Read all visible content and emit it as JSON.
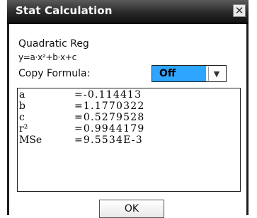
{
  "window": {
    "title": "Stat Calculation"
  },
  "header": {
    "regression_name": "Quadratic Reg",
    "formula": "y=a·x²+b·x+c"
  },
  "copy_formula": {
    "label": "Copy Formula:",
    "selected": "Off"
  },
  "results": {
    "rows": [
      {
        "key": "a",
        "value": "=-0.114413"
      },
      {
        "key": "b",
        "value": "=1.1770322"
      },
      {
        "key": "c",
        "value": "=0.5279528"
      },
      {
        "key": "r²",
        "value": "=0.9944179"
      },
      {
        "key": "MSe",
        "value": "=9.5534E-3"
      }
    ]
  },
  "buttons": {
    "ok": "OK",
    "close": "✕"
  },
  "colors": {
    "selected_bg": "#2ea5ff",
    "titlebar": "#2a2a2a"
  }
}
